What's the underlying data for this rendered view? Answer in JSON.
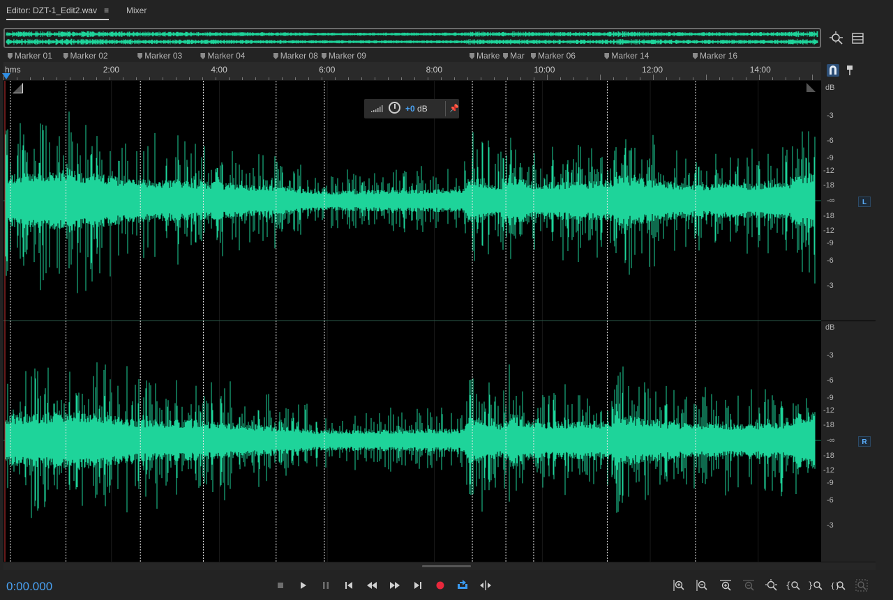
{
  "tabs": {
    "editor": "Editor: DZT-1_Edit2.wav",
    "editor_menu": "≡",
    "mixer": "Mixer"
  },
  "markers": [
    {
      "label": "Marker 01",
      "pos": 0.005
    },
    {
      "label": "Marker 02",
      "pos": 0.073
    },
    {
      "label": "Marker 03",
      "pos": 0.164
    },
    {
      "label": "Marker 04",
      "pos": 0.241
    },
    {
      "label": "Marker 08",
      "pos": 0.33
    },
    {
      "label": "Marker 09",
      "pos": 0.389
    },
    {
      "label": "Marke",
      "pos": 0.57
    },
    {
      "label": "Mar",
      "pos": 0.611
    },
    {
      "label": "Marker 06",
      "pos": 0.645
    },
    {
      "label": "Marker 14",
      "pos": 0.735
    },
    {
      "label": "Marker 16",
      "pos": 0.843
    }
  ],
  "ruler": {
    "unit": "hms",
    "ticks": [
      {
        "label": "2:00",
        "pos": 0.132
      },
      {
        "label": "4:00",
        "pos": 0.264
      },
      {
        "label": "6:00",
        "pos": 0.396
      },
      {
        "label": "8:00",
        "pos": 0.527
      },
      {
        "label": "10:00",
        "pos": 0.659
      },
      {
        "label": "12:00",
        "pos": 0.791
      },
      {
        "label": "14:00",
        "pos": 0.923
      }
    ]
  },
  "hud": {
    "value": "+0",
    "unit": "dB"
  },
  "db_scale": {
    "top": [
      "dB",
      "-3",
      "-6",
      "-9",
      "-12",
      "-18",
      "-∞",
      "-18",
      "-12",
      "-9",
      "-6",
      "-3"
    ],
    "bottom": [
      "dB",
      "-3",
      "-6",
      "-9",
      "-12",
      "-18",
      "-∞",
      "-18",
      "-12",
      "-9",
      "-6",
      "-3"
    ],
    "left_channel": "L",
    "right_channel": "R"
  },
  "transport": {
    "time": "0:00.000"
  },
  "colors": {
    "waveform": "#1ed49a",
    "accent": "#4aa3f5",
    "record": "#e8283c"
  }
}
